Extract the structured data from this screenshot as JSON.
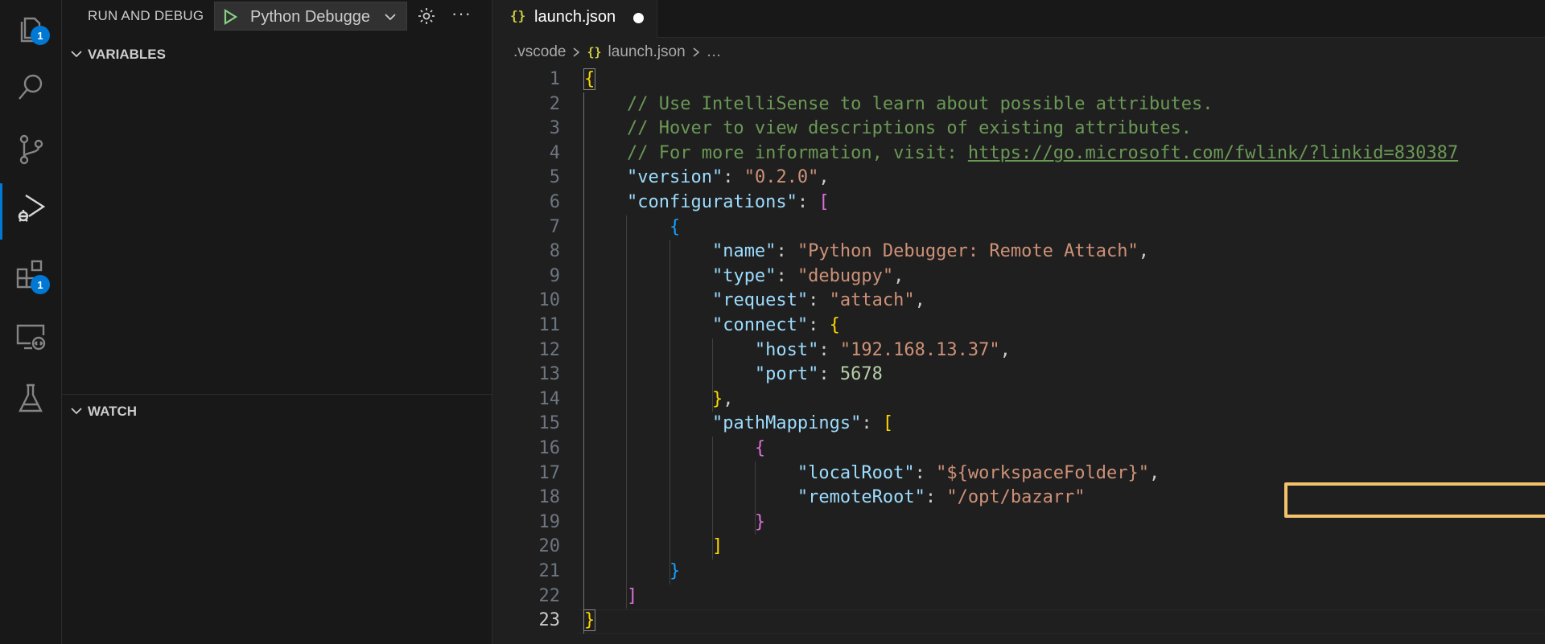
{
  "activity_bar": {
    "items": [
      {
        "name": "explorer",
        "icon": "files-icon",
        "badge": "1"
      },
      {
        "name": "search",
        "icon": "search-icon"
      },
      {
        "name": "source-control",
        "icon": "source-control-icon"
      },
      {
        "name": "run-and-debug",
        "icon": "debug-icon",
        "active": true
      },
      {
        "name": "extensions",
        "icon": "extensions-icon",
        "badge": "1"
      },
      {
        "name": "remote-explorer",
        "icon": "remote-explorer-icon"
      },
      {
        "name": "testing",
        "icon": "flask-icon"
      }
    ],
    "accent_color": "#0078d4"
  },
  "sidebar": {
    "title": "RUN AND DEBUG",
    "config_select": "Python Debugge",
    "sections": {
      "variables": "VARIABLES",
      "watch": "WATCH"
    }
  },
  "editor": {
    "tab": {
      "label": "launch.json",
      "icon": "{}",
      "modified": true
    },
    "breadcrumb": {
      "folder": ".vscode",
      "file_icon": "{}",
      "file": "launch.json",
      "more": "…"
    },
    "current_line": "23",
    "lines": [
      {
        "n": "1",
        "t": [
          [
            "b1",
            "{"
          ]
        ]
      },
      {
        "n": "2",
        "t": [
          [
            "ws",
            "    "
          ],
          [
            "c-com",
            "// Use IntelliSense to learn about possible attributes."
          ]
        ]
      },
      {
        "n": "3",
        "t": [
          [
            "ws",
            "    "
          ],
          [
            "c-com",
            "// Hover to view descriptions of existing attributes."
          ]
        ]
      },
      {
        "n": "4",
        "t": [
          [
            "ws",
            "    "
          ],
          [
            "c-com",
            "// For more information, visit: "
          ],
          [
            "c-link",
            "https://go.microsoft.com/fwlink/?linkid=830387"
          ]
        ]
      },
      {
        "n": "5",
        "t": [
          [
            "ws",
            "    "
          ],
          [
            "c-key",
            "\"version\""
          ],
          [
            "c-pun",
            ": "
          ],
          [
            "c-str",
            "\"0.2.0\""
          ],
          [
            "c-pun",
            ","
          ]
        ]
      },
      {
        "n": "6",
        "t": [
          [
            "ws",
            "    "
          ],
          [
            "c-key",
            "\"configurations\""
          ],
          [
            "c-pun",
            ": "
          ],
          [
            "b2",
            "["
          ]
        ]
      },
      {
        "n": "7",
        "t": [
          [
            "ws",
            "        "
          ],
          [
            "b3",
            "{"
          ]
        ]
      },
      {
        "n": "8",
        "t": [
          [
            "ws",
            "            "
          ],
          [
            "c-key",
            "\"name\""
          ],
          [
            "c-pun",
            ": "
          ],
          [
            "c-str",
            "\"Python Debugger: Remote Attach\""
          ],
          [
            "c-pun",
            ","
          ]
        ]
      },
      {
        "n": "9",
        "t": [
          [
            "ws",
            "            "
          ],
          [
            "c-key",
            "\"type\""
          ],
          [
            "c-pun",
            ": "
          ],
          [
            "c-str",
            "\"debugpy\""
          ],
          [
            "c-pun",
            ","
          ]
        ]
      },
      {
        "n": "10",
        "t": [
          [
            "ws",
            "            "
          ],
          [
            "c-key",
            "\"request\""
          ],
          [
            "c-pun",
            ": "
          ],
          [
            "c-str",
            "\"attach\""
          ],
          [
            "c-pun",
            ","
          ]
        ]
      },
      {
        "n": "11",
        "t": [
          [
            "ws",
            "            "
          ],
          [
            "c-key",
            "\"connect\""
          ],
          [
            "c-pun",
            ": "
          ],
          [
            "b1",
            "{"
          ]
        ]
      },
      {
        "n": "12",
        "t": [
          [
            "ws",
            "                "
          ],
          [
            "c-key",
            "\"host\""
          ],
          [
            "c-pun",
            ": "
          ],
          [
            "c-str",
            "\"192.168.13.37\""
          ],
          [
            "c-pun",
            ","
          ]
        ]
      },
      {
        "n": "13",
        "t": [
          [
            "ws",
            "                "
          ],
          [
            "c-key",
            "\"port\""
          ],
          [
            "c-pun",
            ": "
          ],
          [
            "c-num",
            "5678"
          ]
        ]
      },
      {
        "n": "14",
        "t": [
          [
            "ws",
            "            "
          ],
          [
            "b1",
            "}"
          ],
          [
            "c-pun",
            ","
          ]
        ]
      },
      {
        "n": "15",
        "t": [
          [
            "ws",
            "            "
          ],
          [
            "c-key",
            "\"pathMappings\""
          ],
          [
            "c-pun",
            ": "
          ],
          [
            "b1",
            "["
          ]
        ]
      },
      {
        "n": "16",
        "t": [
          [
            "ws",
            "                "
          ],
          [
            "b2",
            "{"
          ]
        ]
      },
      {
        "n": "17",
        "t": [
          [
            "ws",
            "                    "
          ],
          [
            "c-key",
            "\"localRoot\""
          ],
          [
            "c-pun",
            ": "
          ],
          [
            "c-str",
            "\"${workspaceFolder}\""
          ],
          [
            "c-pun",
            ","
          ]
        ]
      },
      {
        "n": "18",
        "t": [
          [
            "ws",
            "                    "
          ],
          [
            "c-key",
            "\"remoteRoot\""
          ],
          [
            "c-pun",
            ": "
          ],
          [
            "c-str",
            "\"/opt/bazarr\""
          ]
        ]
      },
      {
        "n": "19",
        "t": [
          [
            "ws",
            "                "
          ],
          [
            "b2",
            "}"
          ]
        ]
      },
      {
        "n": "20",
        "t": [
          [
            "ws",
            "            "
          ],
          [
            "b1",
            "]"
          ]
        ]
      },
      {
        "n": "21",
        "t": [
          [
            "ws",
            "        "
          ],
          [
            "b3",
            "}"
          ]
        ]
      },
      {
        "n": "22",
        "t": [
          [
            "ws",
            "    "
          ],
          [
            "b2",
            "]"
          ]
        ]
      },
      {
        "n": "23",
        "t": [
          [
            "b1",
            "}"
          ]
        ]
      }
    ],
    "highlight_color": "#f2c36b"
  }
}
